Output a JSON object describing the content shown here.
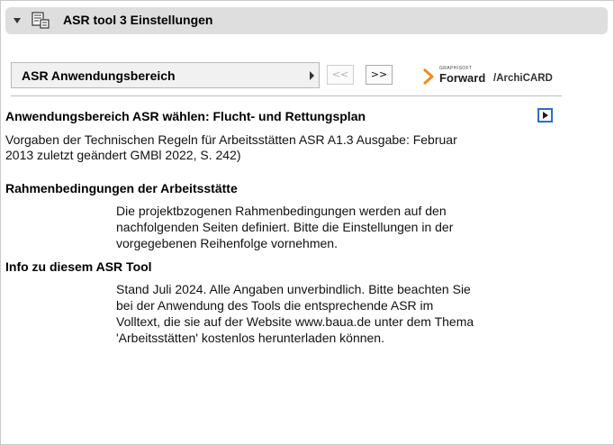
{
  "header": {
    "title": "ASR tool 3 Einstellungen",
    "icon": "settings-document-icon"
  },
  "toolbar": {
    "dropdown_label": "ASR Anwendungsbereich",
    "prev_label": "<<",
    "next_label": ">>",
    "logo": {
      "brand_small": "GRAPHISOFT",
      "brand_main": "Forward",
      "product": "/ArchiCARD"
    }
  },
  "sections": {
    "scope": {
      "heading": "Anwendungsbereich ASR wählen: Flucht- und Rettungsplan",
      "lines": [
        "Vorgaben der Technischen Regeln für Arbeitsstätten ASR A1.3 Ausgabe: Februar",
        "2013 zuletzt geändert GMBl 2022, S. 242)"
      ]
    },
    "conditions": {
      "heading": "Rahmenbedingungen der Arbeitsstätte",
      "lines": [
        "Die projektbzogenen Rahmenbedingungen werden auf den",
        "nachfolgenden Seiten definiert. Bitte die Einstellungen in der",
        "vorgegebenen Reihenfolge vornehmen."
      ]
    },
    "info": {
      "heading": "Info zu diesem ASR Tool",
      "lines": [
        "Stand Juli 2024. Alle Angaben unverbindlich. Bitte beachten Sie",
        "bei der Anwendung des Tools die entsprechende ASR im",
        "Volltext, die sie auf der Website www.baua.de unter dem Thema",
        "'Arbeitsstätten' kostenlos herunterladen können."
      ]
    }
  },
  "colors": {
    "header_bg": "#dedede",
    "accent_blue": "#2b6fc9",
    "logo_orange": "#f08a1c"
  }
}
